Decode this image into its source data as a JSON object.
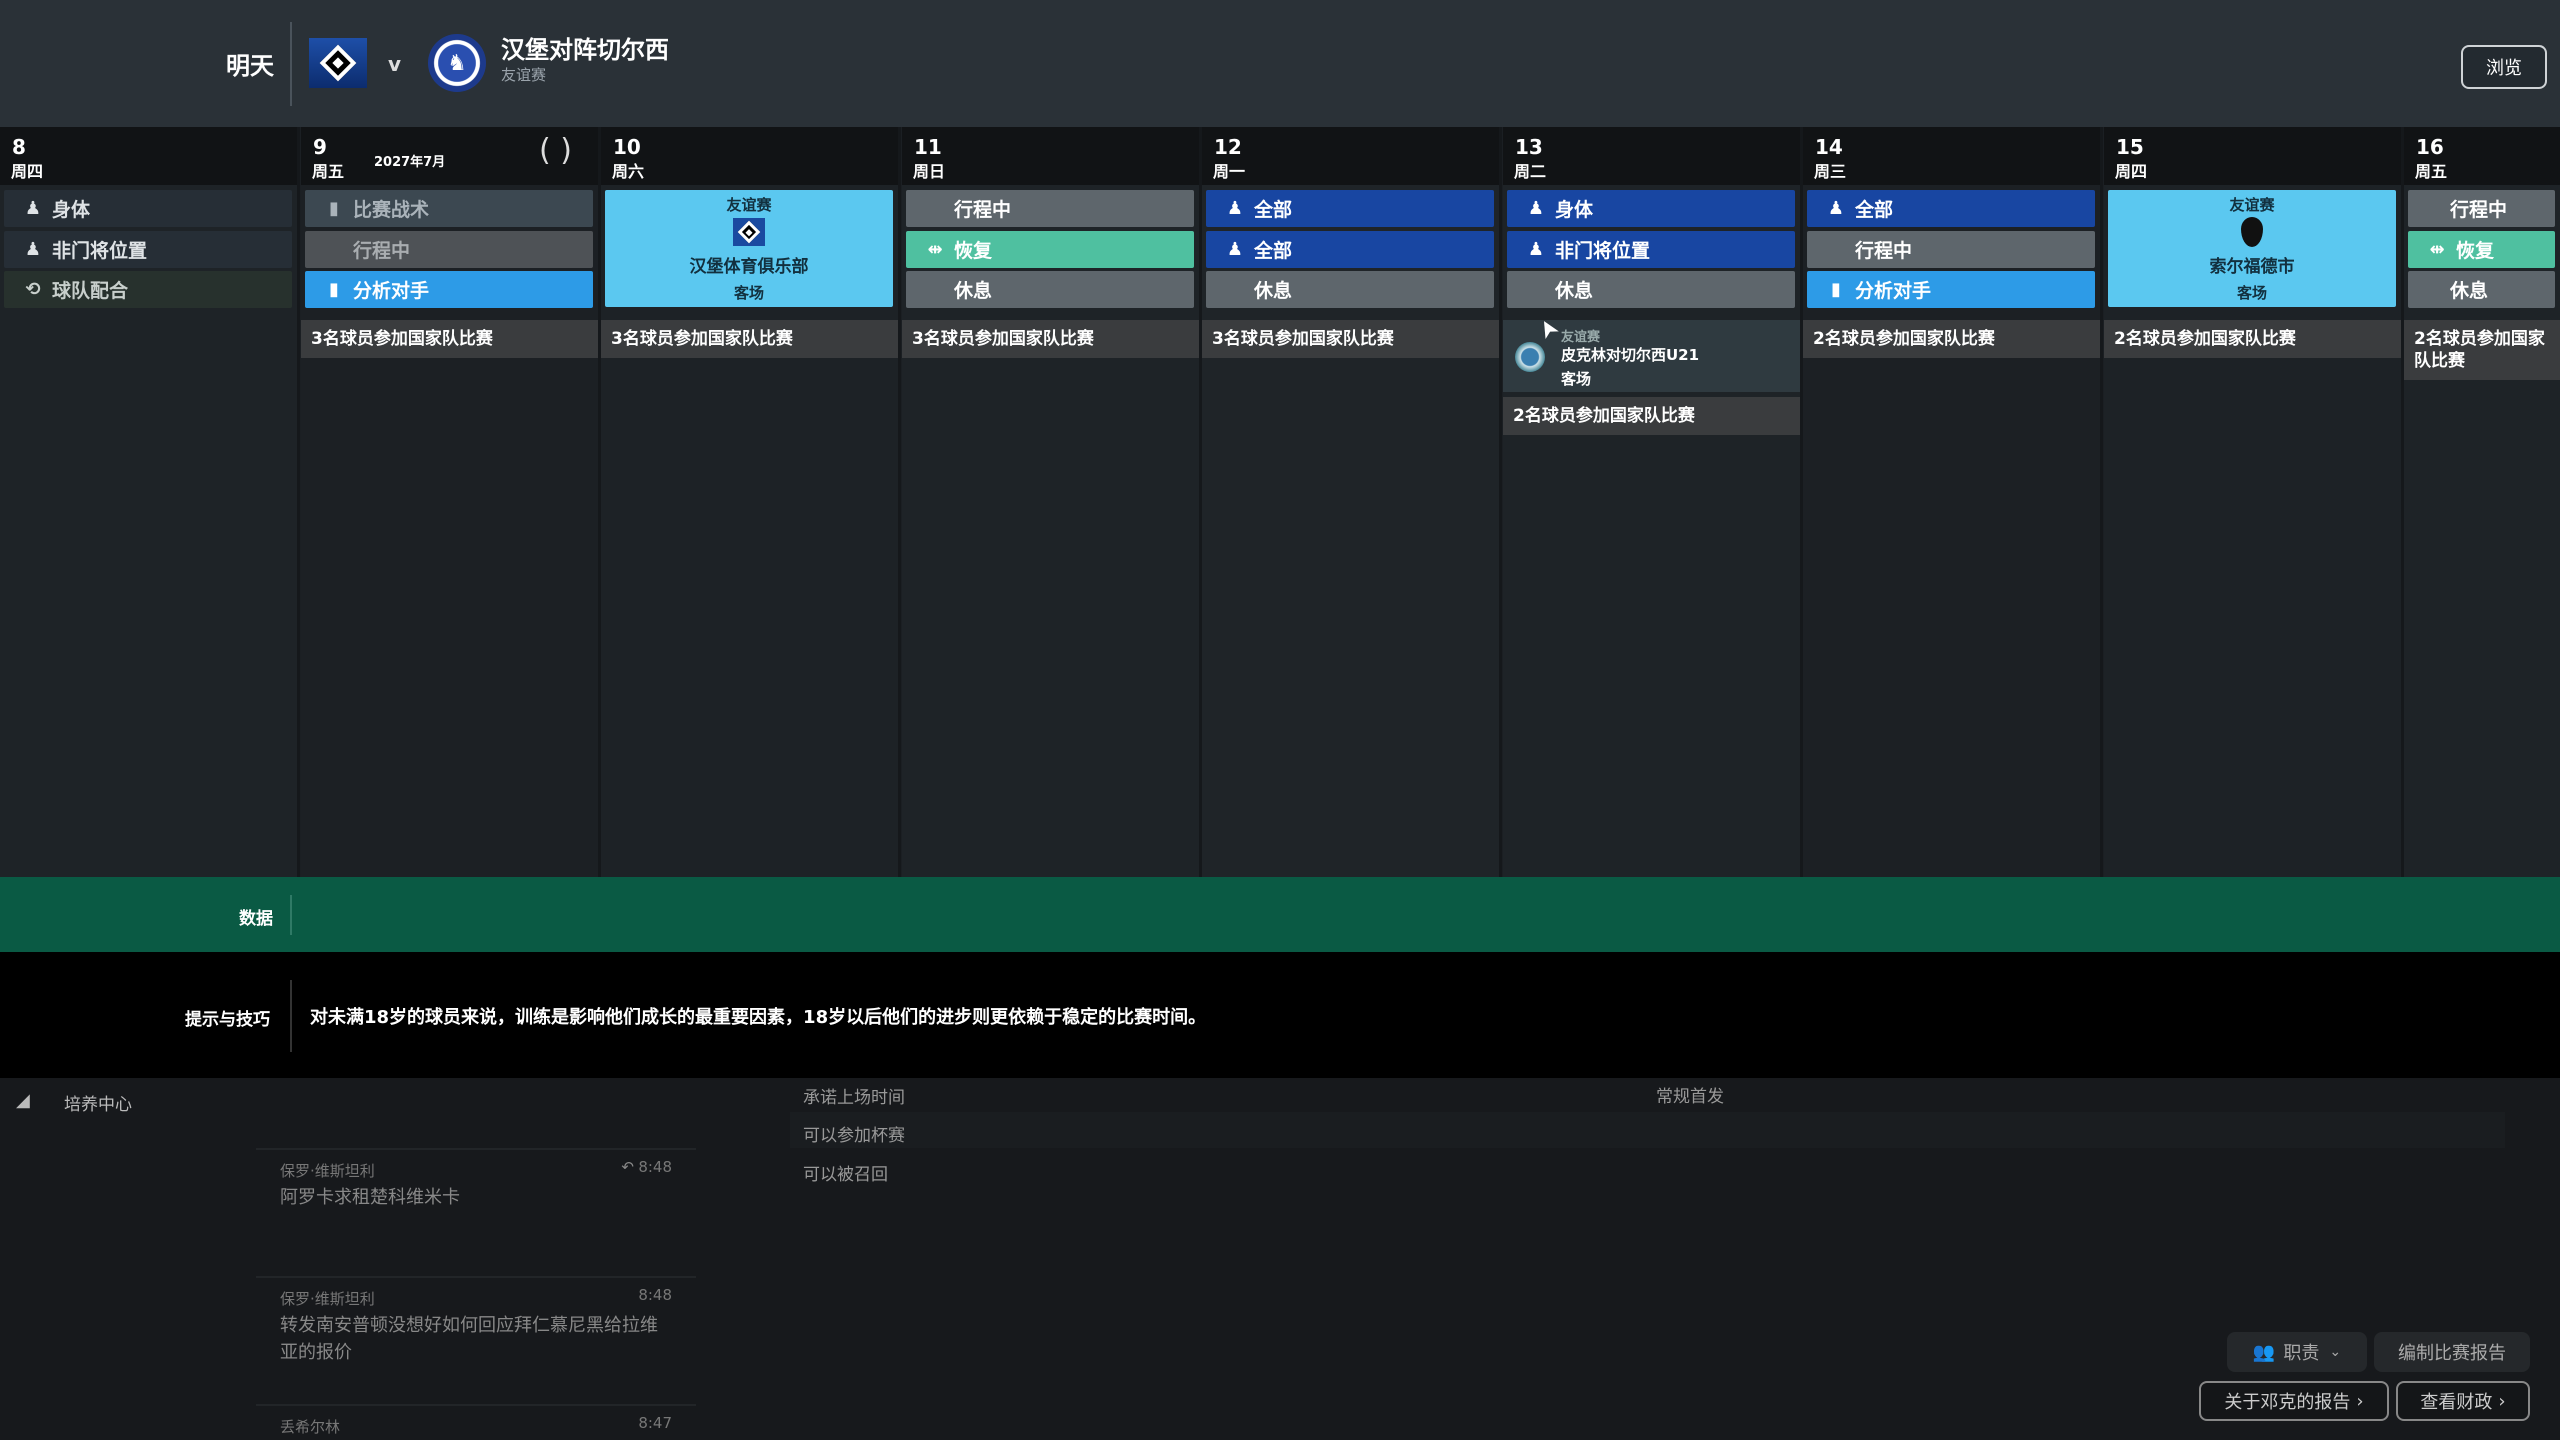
{
  "header": {
    "when": "明天",
    "vs": "v",
    "title": "汉堡对阵切尔西",
    "subtitle": "友谊赛",
    "browse": "浏览",
    "month": "2027年7月"
  },
  "colors": {
    "body": "#262e36",
    "team": "#27312d",
    "tactic": "#3c4851",
    "travel_dim": "#4e5256",
    "analysis": "#2d9be7",
    "grey": "#5e666c",
    "recovery": "#4fc0a0",
    "blue": "#1846a2",
    "match": "#5bc8f0"
  },
  "columns": [
    {
      "day": "8",
      "weekday": "周四",
      "activities": [
        {
          "label": "身体",
          "type": "body",
          "icon": "person-icon"
        },
        {
          "label": "非门将位置",
          "type": "body",
          "icon": "person-icon"
        },
        {
          "label": "球队配合",
          "type": "team",
          "icon": "team-icon"
        }
      ]
    },
    {
      "day": "9",
      "weekday": "周五",
      "activities": [
        {
          "label": "比赛战术",
          "type": "tactic",
          "icon": "document-icon"
        },
        {
          "label": "行程中",
          "type": "travel_dim",
          "icon": ""
        },
        {
          "label": "分析对手",
          "type": "analysis",
          "icon": "document-icon"
        }
      ],
      "national": "3名球员参加国家队比赛"
    },
    {
      "day": "10",
      "weekday": "周六",
      "match": {
        "type": "友谊赛",
        "opponent": "汉堡体育俱乐部",
        "venue": "客场",
        "logo": "hamburg-crest-icon"
      },
      "national": "3名球员参加国家队比赛"
    },
    {
      "day": "11",
      "weekday": "周日",
      "activities": [
        {
          "label": "行程中",
          "type": "grey",
          "icon": ""
        },
        {
          "label": "恢复",
          "type": "recovery",
          "icon": "recovery-icon"
        },
        {
          "label": "休息",
          "type": "grey",
          "icon": ""
        }
      ],
      "national": "3名球员参加国家队比赛"
    },
    {
      "day": "12",
      "weekday": "周一",
      "activities": [
        {
          "label": "全部",
          "type": "blue",
          "icon": "person-icon"
        },
        {
          "label": "全部",
          "type": "blue",
          "icon": "person-icon"
        },
        {
          "label": "休息",
          "type": "grey",
          "icon": ""
        }
      ],
      "national": "3名球员参加国家队比赛"
    },
    {
      "day": "13",
      "weekday": "周二",
      "activities": [
        {
          "label": "身体",
          "type": "blue",
          "icon": "person-icon"
        },
        {
          "label": "非门将位置",
          "type": "blue",
          "icon": "person-icon"
        },
        {
          "label": "休息",
          "type": "grey",
          "icon": ""
        }
      ],
      "extra": {
        "type": "友谊赛",
        "name": "皮克林对切尔西U21",
        "venue": "客场"
      },
      "national": "2名球员参加国家队比赛"
    },
    {
      "day": "14",
      "weekday": "周三",
      "activities": [
        {
          "label": "全部",
          "type": "blue",
          "icon": "person-icon"
        },
        {
          "label": "行程中",
          "type": "grey",
          "icon": ""
        },
        {
          "label": "分析对手",
          "type": "analysis",
          "icon": "document-icon"
        }
      ],
      "national": "2名球员参加国家队比赛"
    },
    {
      "day": "15",
      "weekday": "周四",
      "match": {
        "type": "友谊赛",
        "opponent": "索尔福德市",
        "venue": "客场",
        "logo": "salford-crest-icon"
      },
      "national": "2名球员参加国家队比赛"
    },
    {
      "day": "16",
      "weekday": "周五",
      "activities": [
        {
          "label": "行程中",
          "type": "grey",
          "icon": ""
        },
        {
          "label": "恢复",
          "type": "recovery",
          "icon": "recovery-icon"
        },
        {
          "label": "休息",
          "type": "grey",
          "icon": ""
        }
      ],
      "national": "2名球员参加国家队比赛"
    }
  ],
  "data_bar": {
    "label": "数据"
  },
  "tips": {
    "label": "提示与技巧",
    "text": "对未满18岁的球员来说，训练是影响他们成长的最重要因素，18岁以后他们的进步则更依赖于稳定的比赛时间。"
  },
  "bottom": {
    "section": "培养中心",
    "news": [
      {
        "author": "保罗·维斯坦利",
        "time": "8:48",
        "subject": "阿罗卡求租楚科维米卡"
      },
      {
        "author": "保罗·维斯坦利",
        "time": "8:48",
        "subject": "转发南安普顿没想好如何回应拜仁慕尼黑给拉维亚的报价"
      },
      {
        "author": "丢希尔林",
        "time": "8:47",
        "subject": ""
      }
    ],
    "options": [
      "承诺上场时间",
      "可以参加杯赛",
      "可以被召回"
    ],
    "regular": "常规首发",
    "buttons": {
      "duties": "职责",
      "match_report": "编制比赛报告",
      "scout_report": "关于邓克的报告",
      "finances": "查看财政"
    }
  }
}
